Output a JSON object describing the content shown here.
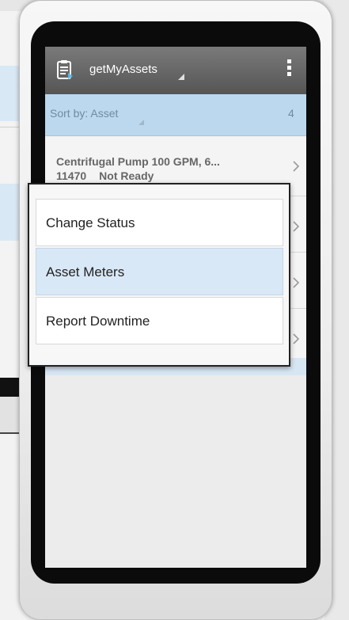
{
  "header": {
    "title": "getMyAssets"
  },
  "sortbar": {
    "label": "Sort by: Asset",
    "count": "4"
  },
  "assets": [
    {
      "title": "Centrifugal Pump 100 GPM, 6...",
      "asset_num": "11470",
      "status": "Not Ready"
    }
  ],
  "popup_menu": {
    "items": [
      "Change Status",
      "Asset Meters",
      "Report Downtime"
    ],
    "highlighted_index": 1
  },
  "colors": {
    "header": "#5f5f5f",
    "sortbar": "#bcd8ee",
    "highlight": "#d9e8f6",
    "bezel": "#0b0b0b"
  }
}
